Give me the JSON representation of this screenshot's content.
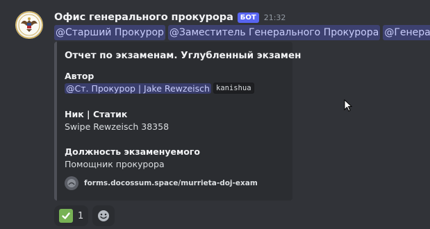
{
  "message": {
    "username": "Офис генерального прокурора",
    "bot_tag": "БОТ",
    "timestamp": "21:32",
    "mentions": [
      "@Старший Прокурор",
      "@Заместитель Генерального Прокурора",
      "@Генеральный Прокурор"
    ]
  },
  "embed": {
    "title": "Отчет по экзаменам. Углубленный экзамен",
    "fields": [
      {
        "name": "Автор",
        "mention": "@Ст. Прокурор | Jake Rewzeisch",
        "code": "kanishua"
      },
      {
        "name": "Ник | Статик",
        "value": "Swipe Rewzeisch 38358"
      },
      {
        "name": "Должность экзаменуемого",
        "value": "Помощник прокурора"
      }
    ],
    "footer": "forms.docossum.space/murrieta-doj-exam"
  },
  "reactions": [
    {
      "emoji": "white-check-mark",
      "count": "1"
    }
  ],
  "colors": {
    "background": "#313338",
    "embed_bg": "#2b2d31",
    "embed_border": "#4e5058",
    "mention_text": "#c9cdfb",
    "bot_tag": "#5865f2"
  }
}
